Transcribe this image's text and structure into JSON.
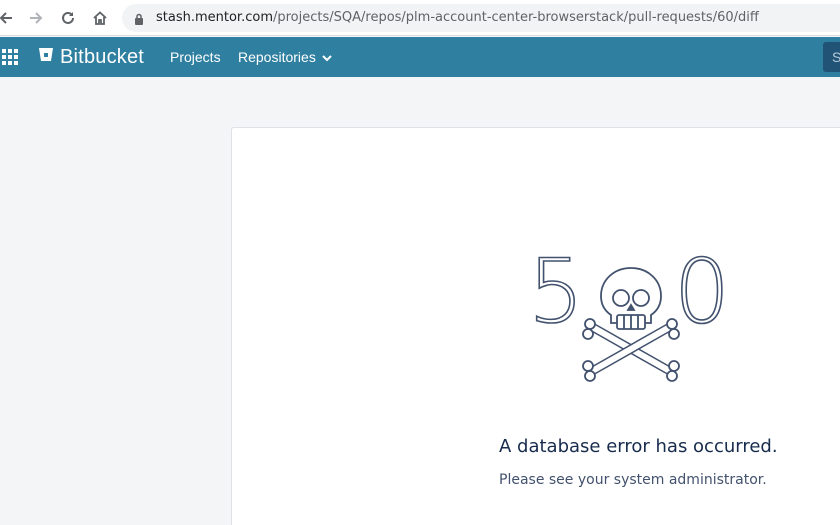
{
  "browser": {
    "url_host": "stash.mentor.com",
    "url_path": "/projects/SQA/repos/plm-account-center-browserstack/pull-requests/60/diff"
  },
  "header": {
    "brand": "Bitbucket",
    "nav": {
      "projects": "Projects",
      "repositories": "Repositories"
    },
    "search_stub": "S"
  },
  "error": {
    "code_left": "5",
    "code_right": "0",
    "title": "A database error has occurred.",
    "subtitle": "Please see your system administrator."
  },
  "icons": [
    "back-icon",
    "forward-icon",
    "reload-icon",
    "home-icon",
    "lock-icon",
    "app-switcher-icon",
    "bitbucket-logo-icon",
    "chevron-down-icon",
    "skull-crossbones-icon"
  ],
  "colors": {
    "header_bg": "#2f7fa0",
    "page_bg": "#f4f5f7",
    "title_text": "#172b4d"
  }
}
